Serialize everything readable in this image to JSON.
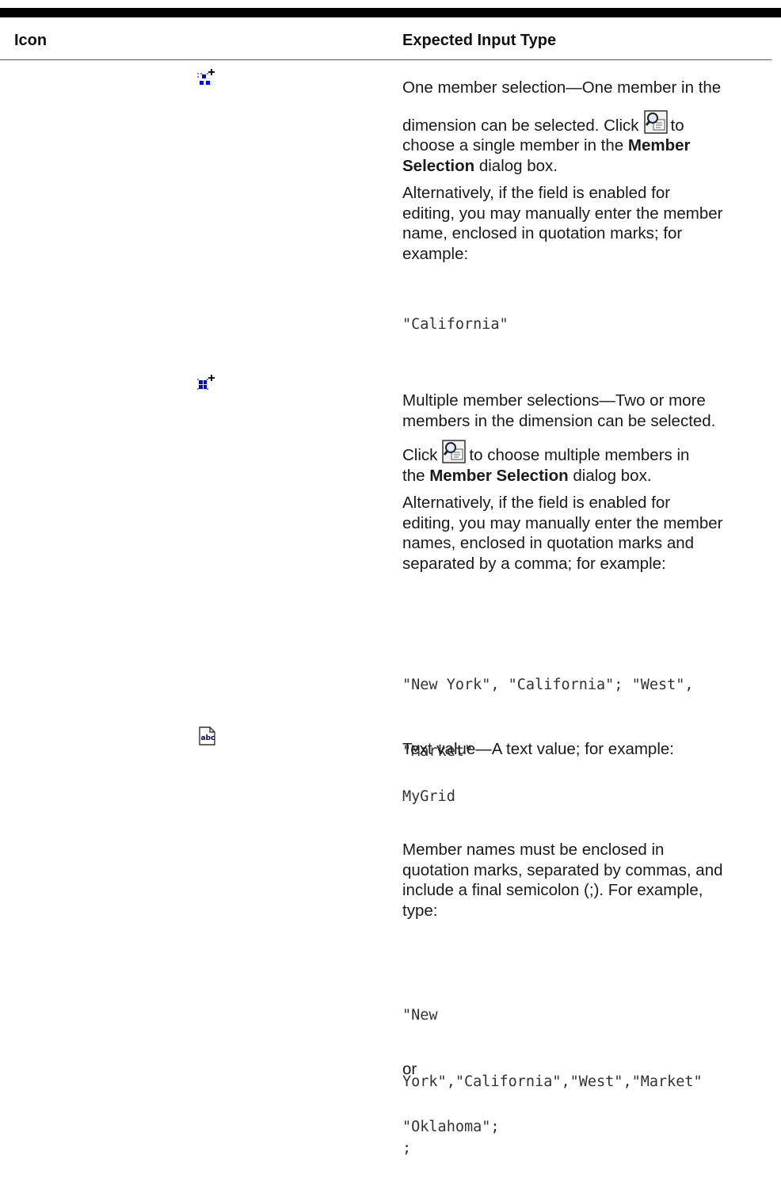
{
  "header": {
    "col_icon": "Icon",
    "col_input": "Expected Input Type"
  },
  "rows": [
    {
      "icon": "one-member-selection-icon",
      "p1_a": "One member selection—One member in the",
      "p1_b": "dimension can be selected. Click",
      "p1_c": "to",
      "p1_d": "choose a single member in the",
      "p1_bold1": "Member",
      "p1_bold2": "Selection",
      "p1_e": "dialog box.",
      "p2": [
        "Alternatively, if the field is enabled for",
        "editing, you may manually enter the member",
        "name, enclosed in quotation marks; for",
        "example:"
      ],
      "code": "\"California\""
    },
    {
      "icon": "multiple-member-selection-icon",
      "p1": [
        "Multiple member selections—Two or more",
        "members in the dimension can be selected."
      ],
      "p2_a": "Click",
      "p2_b": "to choose multiple members in",
      "p2_c": "the",
      "p2_bold": "Member Selection",
      "p2_d": "dialog box.",
      "p3": [
        "Alternatively, if the field is enabled for",
        "editing, you may manually enter the member",
        "names, enclosed in quotation marks and",
        "separated by a comma; for example:"
      ],
      "code": [
        "\"New York\", \"California\"; \"West\",",
        "\"Market\""
      ]
    },
    {
      "icon": "text-value-icon",
      "p1": "Text value—A text value; for example:",
      "code1": "MyGrid",
      "p2": [
        "Member names must be enclosed in",
        "quotation marks, separated by commas, and",
        "include a final semicolon (;). For example,",
        "type:"
      ],
      "code2": [
        "\"New",
        "York\",\"California\",\"West\",\"Market\"",
        ";"
      ],
      "or": "or",
      "code3": "\"Oklahoma\";"
    }
  ],
  "colors": {
    "icon_blue": "#0000ff",
    "rule": "#000000"
  }
}
